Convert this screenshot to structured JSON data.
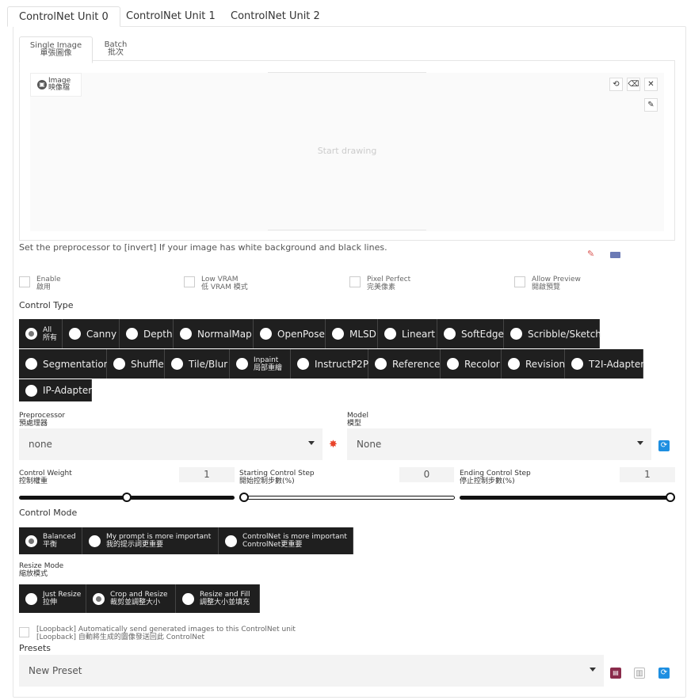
{
  "tabs": [
    "ControlNet Unit 0",
    "ControlNet Unit 1",
    "ControlNet Unit 2"
  ],
  "subtabs": {
    "single": {
      "en": "Single Image",
      "zh": "單張圖像"
    },
    "batch": {
      "en": "Batch",
      "zh": "批次"
    }
  },
  "image_label": {
    "en": "Image",
    "zh": "映像檔"
  },
  "canvas_placeholder": "Start drawing",
  "hint": "Set the preprocessor to [invert] If your image has white background and black lines.",
  "checkboxes": [
    {
      "en": "Enable",
      "zh": "啟用"
    },
    {
      "en": "Low VRAM",
      "zh": "低 VRAM 模式"
    },
    {
      "en": "Pixel Perfect",
      "zh": "完美像素"
    },
    {
      "en": "Allow Preview",
      "zh": "開啟預覽"
    }
  ],
  "control_type": {
    "label": "Control Type",
    "all": {
      "en": "All",
      "zh": "所有"
    },
    "row1": [
      "Canny",
      "Depth",
      "NormalMap",
      "OpenPose",
      "MLSD",
      "Lineart",
      "SoftEdge",
      "Scribble/Sketch"
    ],
    "row2a": [
      "Segmentation",
      "Shuffle",
      "Tile/Blur"
    ],
    "inpaint": {
      "en": "Inpaint",
      "zh": "局部重繪"
    },
    "row2b": [
      "InstructP2P",
      "Reference",
      "Recolor",
      "Revision",
      "T2I-Adapter"
    ],
    "row3": [
      "IP-Adapter"
    ]
  },
  "preprocessor": {
    "en": "Preprocessor",
    "zh": "預處理器",
    "value": "none"
  },
  "model": {
    "en": "Model",
    "zh": "模型",
    "value": "None"
  },
  "sliders": [
    {
      "en": "Control Weight",
      "zh": "控制權重",
      "value": "1",
      "fraction": 0.5
    },
    {
      "en": "Starting Control Step",
      "zh": "開始控制步數(%)",
      "value": "0",
      "fraction": 0
    },
    {
      "en": "Ending Control Step",
      "zh": "停止控制步數(%)",
      "value": "1",
      "fraction": 1
    }
  ],
  "control_mode": {
    "label": "Control Mode",
    "options": [
      {
        "en": "Balanced",
        "zh": "平衡"
      },
      {
        "en": "My prompt is more important",
        "zh": "我的提示詞更重要"
      },
      {
        "en": "ControlNet is more important",
        "zh": "ControlNet更重要"
      }
    ]
  },
  "resize_mode": {
    "en": "Resize Mode",
    "zh": "縮放模式",
    "options": [
      {
        "en": "Just Resize",
        "zh": "拉伸"
      },
      {
        "en": "Crop and Resize",
        "zh": "裁剪並調整大小"
      },
      {
        "en": "Resize and Fill",
        "zh": "調整大小並填充"
      }
    ]
  },
  "loopback": {
    "en": "[Loopback] Automatically send generated images to this ControlNet unit",
    "zh": "[Loopback] 自動將生成的圖像發送回此 ControlNet"
  },
  "presets": {
    "label": "Presets",
    "value": "New Preset"
  },
  "colors": {
    "dark_button": "#1f1f1f",
    "refresh_blue": "#1e8fe1",
    "save_purple": "#8a2b4b",
    "fire": "#e8442a"
  }
}
